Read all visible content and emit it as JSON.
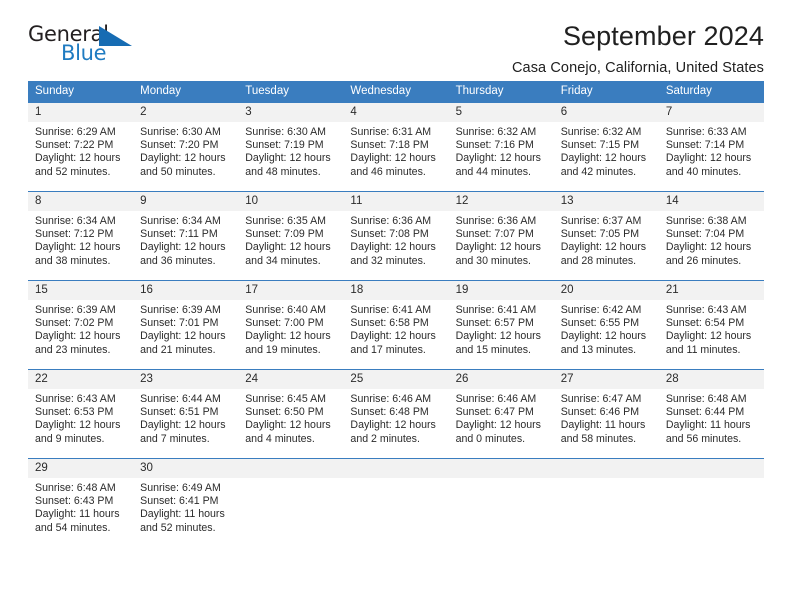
{
  "brand": {
    "name_top": "General",
    "name_bottom": "Blue",
    "color_dark": "#231f20",
    "color_blue": "#166cb3"
  },
  "header": {
    "title": "September 2024",
    "subtitle": "Casa Conejo, California, United States"
  },
  "calendar": {
    "header_bg": "#3a7dbf",
    "daynum_bg": "#f2f2f2",
    "weekdays": [
      "Sunday",
      "Monday",
      "Tuesday",
      "Wednesday",
      "Thursday",
      "Friday",
      "Saturday"
    ],
    "weeks": [
      [
        {
          "day": "1",
          "sunrise": "Sunrise: 6:29 AM",
          "sunset": "Sunset: 7:22 PM",
          "daylight_1": "Daylight: 12 hours",
          "daylight_2": "and 52 minutes."
        },
        {
          "day": "2",
          "sunrise": "Sunrise: 6:30 AM",
          "sunset": "Sunset: 7:20 PM",
          "daylight_1": "Daylight: 12 hours",
          "daylight_2": "and 50 minutes."
        },
        {
          "day": "3",
          "sunrise": "Sunrise: 6:30 AM",
          "sunset": "Sunset: 7:19 PM",
          "daylight_1": "Daylight: 12 hours",
          "daylight_2": "and 48 minutes."
        },
        {
          "day": "4",
          "sunrise": "Sunrise: 6:31 AM",
          "sunset": "Sunset: 7:18 PM",
          "daylight_1": "Daylight: 12 hours",
          "daylight_2": "and 46 minutes."
        },
        {
          "day": "5",
          "sunrise": "Sunrise: 6:32 AM",
          "sunset": "Sunset: 7:16 PM",
          "daylight_1": "Daylight: 12 hours",
          "daylight_2": "and 44 minutes."
        },
        {
          "day": "6",
          "sunrise": "Sunrise: 6:32 AM",
          "sunset": "Sunset: 7:15 PM",
          "daylight_1": "Daylight: 12 hours",
          "daylight_2": "and 42 minutes."
        },
        {
          "day": "7",
          "sunrise": "Sunrise: 6:33 AM",
          "sunset": "Sunset: 7:14 PM",
          "daylight_1": "Daylight: 12 hours",
          "daylight_2": "and 40 minutes."
        }
      ],
      [
        {
          "day": "8",
          "sunrise": "Sunrise: 6:34 AM",
          "sunset": "Sunset: 7:12 PM",
          "daylight_1": "Daylight: 12 hours",
          "daylight_2": "and 38 minutes."
        },
        {
          "day": "9",
          "sunrise": "Sunrise: 6:34 AM",
          "sunset": "Sunset: 7:11 PM",
          "daylight_1": "Daylight: 12 hours",
          "daylight_2": "and 36 minutes."
        },
        {
          "day": "10",
          "sunrise": "Sunrise: 6:35 AM",
          "sunset": "Sunset: 7:09 PM",
          "daylight_1": "Daylight: 12 hours",
          "daylight_2": "and 34 minutes."
        },
        {
          "day": "11",
          "sunrise": "Sunrise: 6:36 AM",
          "sunset": "Sunset: 7:08 PM",
          "daylight_1": "Daylight: 12 hours",
          "daylight_2": "and 32 minutes."
        },
        {
          "day": "12",
          "sunrise": "Sunrise: 6:36 AM",
          "sunset": "Sunset: 7:07 PM",
          "daylight_1": "Daylight: 12 hours",
          "daylight_2": "and 30 minutes."
        },
        {
          "day": "13",
          "sunrise": "Sunrise: 6:37 AM",
          "sunset": "Sunset: 7:05 PM",
          "daylight_1": "Daylight: 12 hours",
          "daylight_2": "and 28 minutes."
        },
        {
          "day": "14",
          "sunrise": "Sunrise: 6:38 AM",
          "sunset": "Sunset: 7:04 PM",
          "daylight_1": "Daylight: 12 hours",
          "daylight_2": "and 26 minutes."
        }
      ],
      [
        {
          "day": "15",
          "sunrise": "Sunrise: 6:39 AM",
          "sunset": "Sunset: 7:02 PM",
          "daylight_1": "Daylight: 12 hours",
          "daylight_2": "and 23 minutes."
        },
        {
          "day": "16",
          "sunrise": "Sunrise: 6:39 AM",
          "sunset": "Sunset: 7:01 PM",
          "daylight_1": "Daylight: 12 hours",
          "daylight_2": "and 21 minutes."
        },
        {
          "day": "17",
          "sunrise": "Sunrise: 6:40 AM",
          "sunset": "Sunset: 7:00 PM",
          "daylight_1": "Daylight: 12 hours",
          "daylight_2": "and 19 minutes."
        },
        {
          "day": "18",
          "sunrise": "Sunrise: 6:41 AM",
          "sunset": "Sunset: 6:58 PM",
          "daylight_1": "Daylight: 12 hours",
          "daylight_2": "and 17 minutes."
        },
        {
          "day": "19",
          "sunrise": "Sunrise: 6:41 AM",
          "sunset": "Sunset: 6:57 PM",
          "daylight_1": "Daylight: 12 hours",
          "daylight_2": "and 15 minutes."
        },
        {
          "day": "20",
          "sunrise": "Sunrise: 6:42 AM",
          "sunset": "Sunset: 6:55 PM",
          "daylight_1": "Daylight: 12 hours",
          "daylight_2": "and 13 minutes."
        },
        {
          "day": "21",
          "sunrise": "Sunrise: 6:43 AM",
          "sunset": "Sunset: 6:54 PM",
          "daylight_1": "Daylight: 12 hours",
          "daylight_2": "and 11 minutes."
        }
      ],
      [
        {
          "day": "22",
          "sunrise": "Sunrise: 6:43 AM",
          "sunset": "Sunset: 6:53 PM",
          "daylight_1": "Daylight: 12 hours",
          "daylight_2": "and 9 minutes."
        },
        {
          "day": "23",
          "sunrise": "Sunrise: 6:44 AM",
          "sunset": "Sunset: 6:51 PM",
          "daylight_1": "Daylight: 12 hours",
          "daylight_2": "and 7 minutes."
        },
        {
          "day": "24",
          "sunrise": "Sunrise: 6:45 AM",
          "sunset": "Sunset: 6:50 PM",
          "daylight_1": "Daylight: 12 hours",
          "daylight_2": "and 4 minutes."
        },
        {
          "day": "25",
          "sunrise": "Sunrise: 6:46 AM",
          "sunset": "Sunset: 6:48 PM",
          "daylight_1": "Daylight: 12 hours",
          "daylight_2": "and 2 minutes."
        },
        {
          "day": "26",
          "sunrise": "Sunrise: 6:46 AM",
          "sunset": "Sunset: 6:47 PM",
          "daylight_1": "Daylight: 12 hours",
          "daylight_2": "and 0 minutes."
        },
        {
          "day": "27",
          "sunrise": "Sunrise: 6:47 AM",
          "sunset": "Sunset: 6:46 PM",
          "daylight_1": "Daylight: 11 hours",
          "daylight_2": "and 58 minutes."
        },
        {
          "day": "28",
          "sunrise": "Sunrise: 6:48 AM",
          "sunset": "Sunset: 6:44 PM",
          "daylight_1": "Daylight: 11 hours",
          "daylight_2": "and 56 minutes."
        }
      ],
      [
        {
          "day": "29",
          "sunrise": "Sunrise: 6:48 AM",
          "sunset": "Sunset: 6:43 PM",
          "daylight_1": "Daylight: 11 hours",
          "daylight_2": "and 54 minutes."
        },
        {
          "day": "30",
          "sunrise": "Sunrise: 6:49 AM",
          "sunset": "Sunset: 6:41 PM",
          "daylight_1": "Daylight: 11 hours",
          "daylight_2": "and 52 minutes."
        },
        {
          "day": "",
          "sunrise": "",
          "sunset": "",
          "daylight_1": "",
          "daylight_2": ""
        },
        {
          "day": "",
          "sunrise": "",
          "sunset": "",
          "daylight_1": "",
          "daylight_2": ""
        },
        {
          "day": "",
          "sunrise": "",
          "sunset": "",
          "daylight_1": "",
          "daylight_2": ""
        },
        {
          "day": "",
          "sunrise": "",
          "sunset": "",
          "daylight_1": "",
          "daylight_2": ""
        },
        {
          "day": "",
          "sunrise": "",
          "sunset": "",
          "daylight_1": "",
          "daylight_2": ""
        }
      ]
    ]
  }
}
